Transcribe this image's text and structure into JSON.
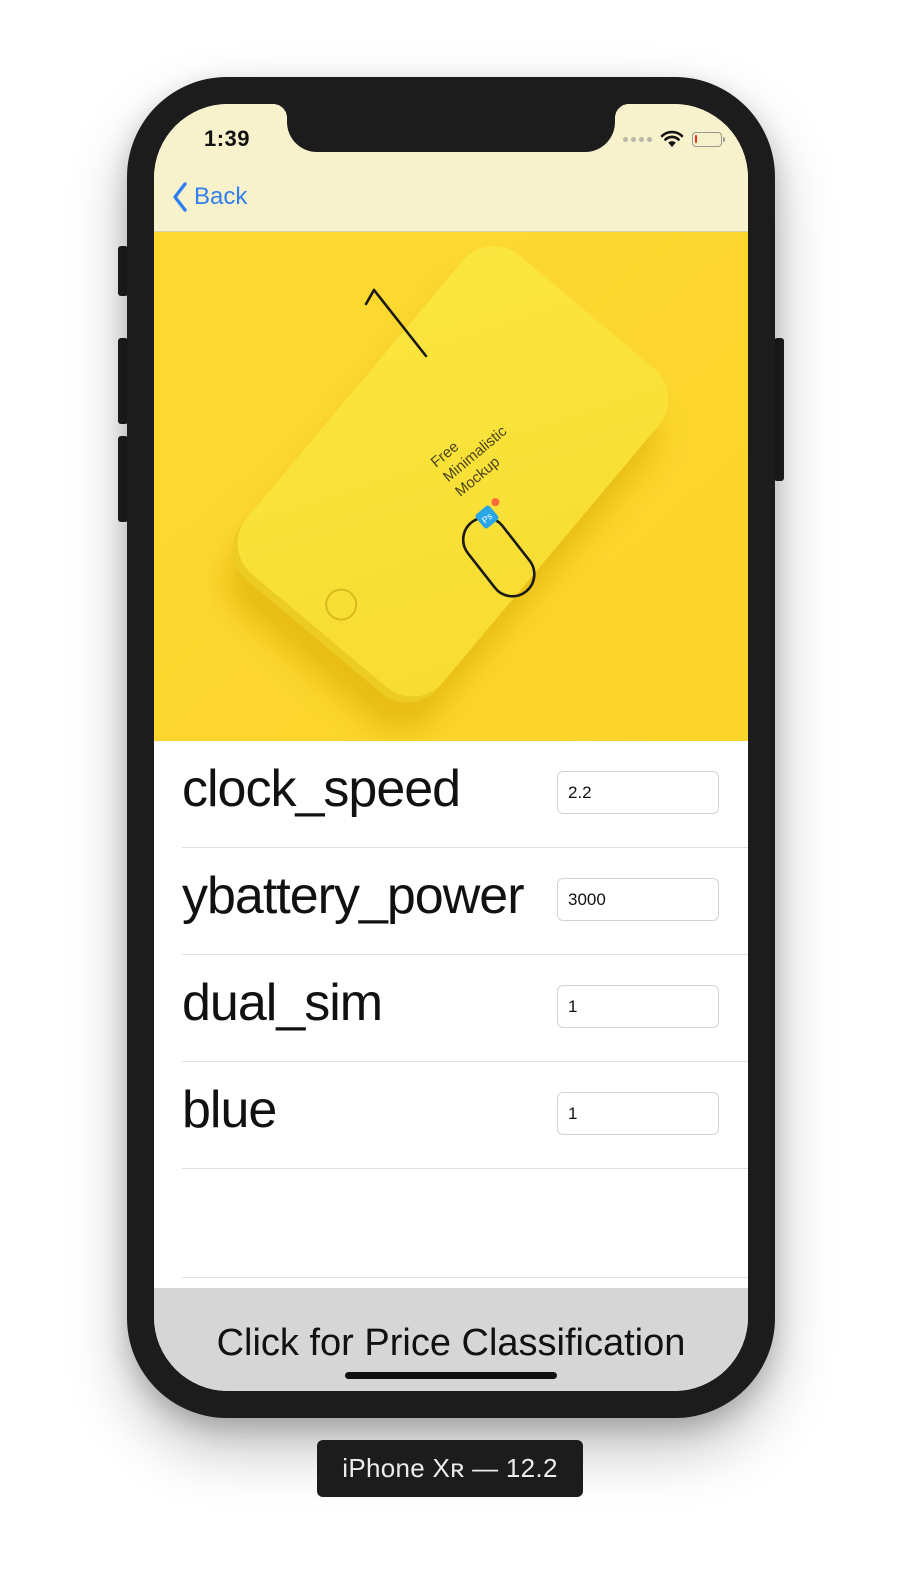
{
  "status_bar": {
    "time": "1:39",
    "battery_level": 0.1
  },
  "nav": {
    "back_label": "Back",
    "accent_color": "#2f7ff2",
    "background_color": "#f8f2cc"
  },
  "hero": {
    "background_color": "#fcd92e",
    "mock_number": "01",
    "mock_line1": "Free",
    "mock_line2": "Minimalistic",
    "mock_line3": "Mockup",
    "badge": "Ps"
  },
  "form": {
    "rows": [
      {
        "label": "clock_speed",
        "value": "2.2"
      },
      {
        "label": "ybattery_power",
        "value": "3000"
      },
      {
        "label": "dual_sim",
        "value": "1"
      },
      {
        "label": "blue",
        "value": "1"
      }
    ]
  },
  "action": {
    "label": "Click for Price Classification"
  },
  "simulator": {
    "device_label": "iPhone Xʀ — 12.2"
  }
}
